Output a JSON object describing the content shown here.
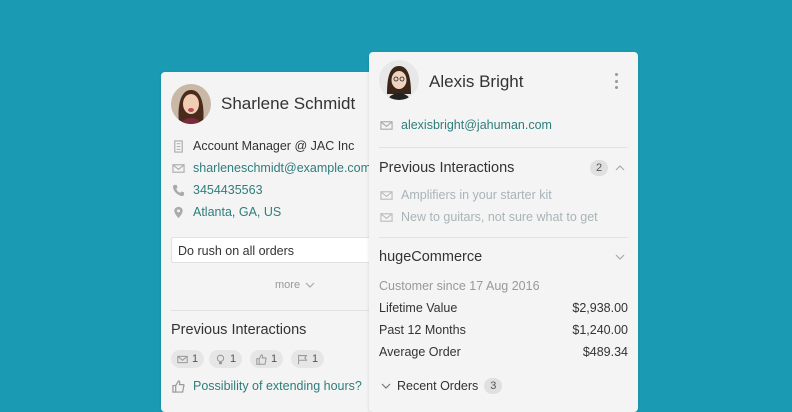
{
  "left_card": {
    "name": "Sharlene Schmidt",
    "details": {
      "title": "Account Manager @ JAC Inc",
      "email": "sharleneschmidt@example.com",
      "phone": "3454435563",
      "location": "Atlanta, GA, US"
    },
    "note": "Do rush on all orders",
    "more_label": "more",
    "previous_interactions": {
      "title": "Previous Interactions",
      "counts": {
        "email": "1",
        "idea": "1",
        "like": "1",
        "flag": "1"
      },
      "items": [
        {
          "text": "Possibility of extending hours?"
        }
      ]
    }
  },
  "right_card": {
    "name": "Alexis Bright",
    "email": "alexisbright@jahuman.com",
    "previous_interactions": {
      "title": "Previous Interactions",
      "count": "2",
      "items": [
        {
          "text": "Amplifiers in your starter kit"
        },
        {
          "text": "New to guitars, not sure what to get"
        }
      ]
    },
    "commerce": {
      "title": "hugeCommerce",
      "since": "Customer since 17 Aug 2016",
      "stats": [
        {
          "label": "Lifetime Value",
          "value": "$2,938.00"
        },
        {
          "label": "Past 12 Months",
          "value": "$1,240.00"
        },
        {
          "label": "Average Order",
          "value": "$489.34"
        }
      ],
      "recent_orders_label": "Recent Orders",
      "recent_orders_count": "3"
    }
  },
  "colors": {
    "background": "#1a9bb3",
    "link": "#2e7d7d",
    "card": "#f4f4f4"
  }
}
